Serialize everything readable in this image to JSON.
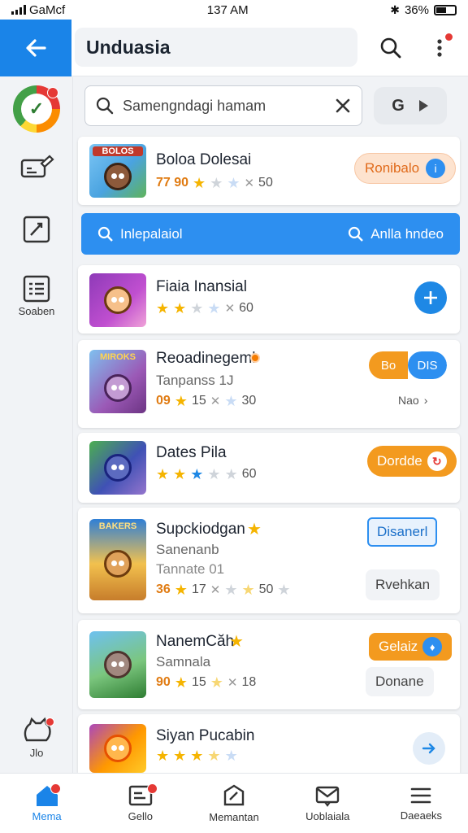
{
  "status": {
    "carrier": "GaMcf",
    "time": "137 AM",
    "battery": "36%"
  },
  "header": {
    "title": "Unduasia",
    "search_icon": "search-icon",
    "more_icon": "more-vertical-icon"
  },
  "sidebar": {
    "items": [
      {
        "icon": "app-logo-icon"
      },
      {
        "icon": "edit-box-icon"
      },
      {
        "icon": "edit-square-icon"
      },
      {
        "icon": "list-icon",
        "label": "Soaben"
      },
      {
        "icon": "settings-cat-icon",
        "label": "Jlo"
      }
    ]
  },
  "search": {
    "placeholder": "Samengndagi hamam",
    "go_label": "G"
  },
  "strip": {
    "left": "Inlepalaiol",
    "right": "Anlla hndeo"
  },
  "apps": [
    {
      "name": "Boloa Dolesai",
      "banner": "BOLOS",
      "score": "77 90",
      "tail": "50",
      "action": "Ronibalo"
    },
    {
      "name": "Fiaia Inansial",
      "tail": "60"
    },
    {
      "name": "Reoadinegeml",
      "banner": "MIROKS",
      "sub": "Tanpanss 1J",
      "score": "09",
      "count": "15",
      "tail": "30",
      "action_a": "Bo",
      "action_b": "DIS",
      "link": "Nao"
    },
    {
      "name": "Dates Pila",
      "tail": "60",
      "action": "Dordde"
    },
    {
      "name": "Supckiodgan",
      "banner": "BAKERS",
      "sub": "Sanenanb",
      "sub2": "Tannate 01",
      "score": "36",
      "count": "17",
      "tail": "50",
      "action": "Disanerl",
      "action2": "Rvehkan"
    },
    {
      "name": "NanemCăh",
      "sub": "Samnala",
      "score": "90",
      "count": "15",
      "tail": "18",
      "action": "Gelaiz",
      "action2": "Donane"
    },
    {
      "name": "Siyan Pucabin"
    }
  ],
  "nav": [
    {
      "label": "Mema",
      "icon": "home-icon"
    },
    {
      "label": "Gello",
      "icon": "inbox-icon"
    },
    {
      "label": "Memantan",
      "icon": "edit-icon"
    },
    {
      "label": "Uoblaiala",
      "icon": "mail-icon"
    },
    {
      "label": "Daeaeks",
      "icon": "menu-icon"
    }
  ],
  "colors": {
    "primary": "#1a84e8",
    "orange": "#f39a1f",
    "star": "#f5b400",
    "badge": "#e53935"
  }
}
